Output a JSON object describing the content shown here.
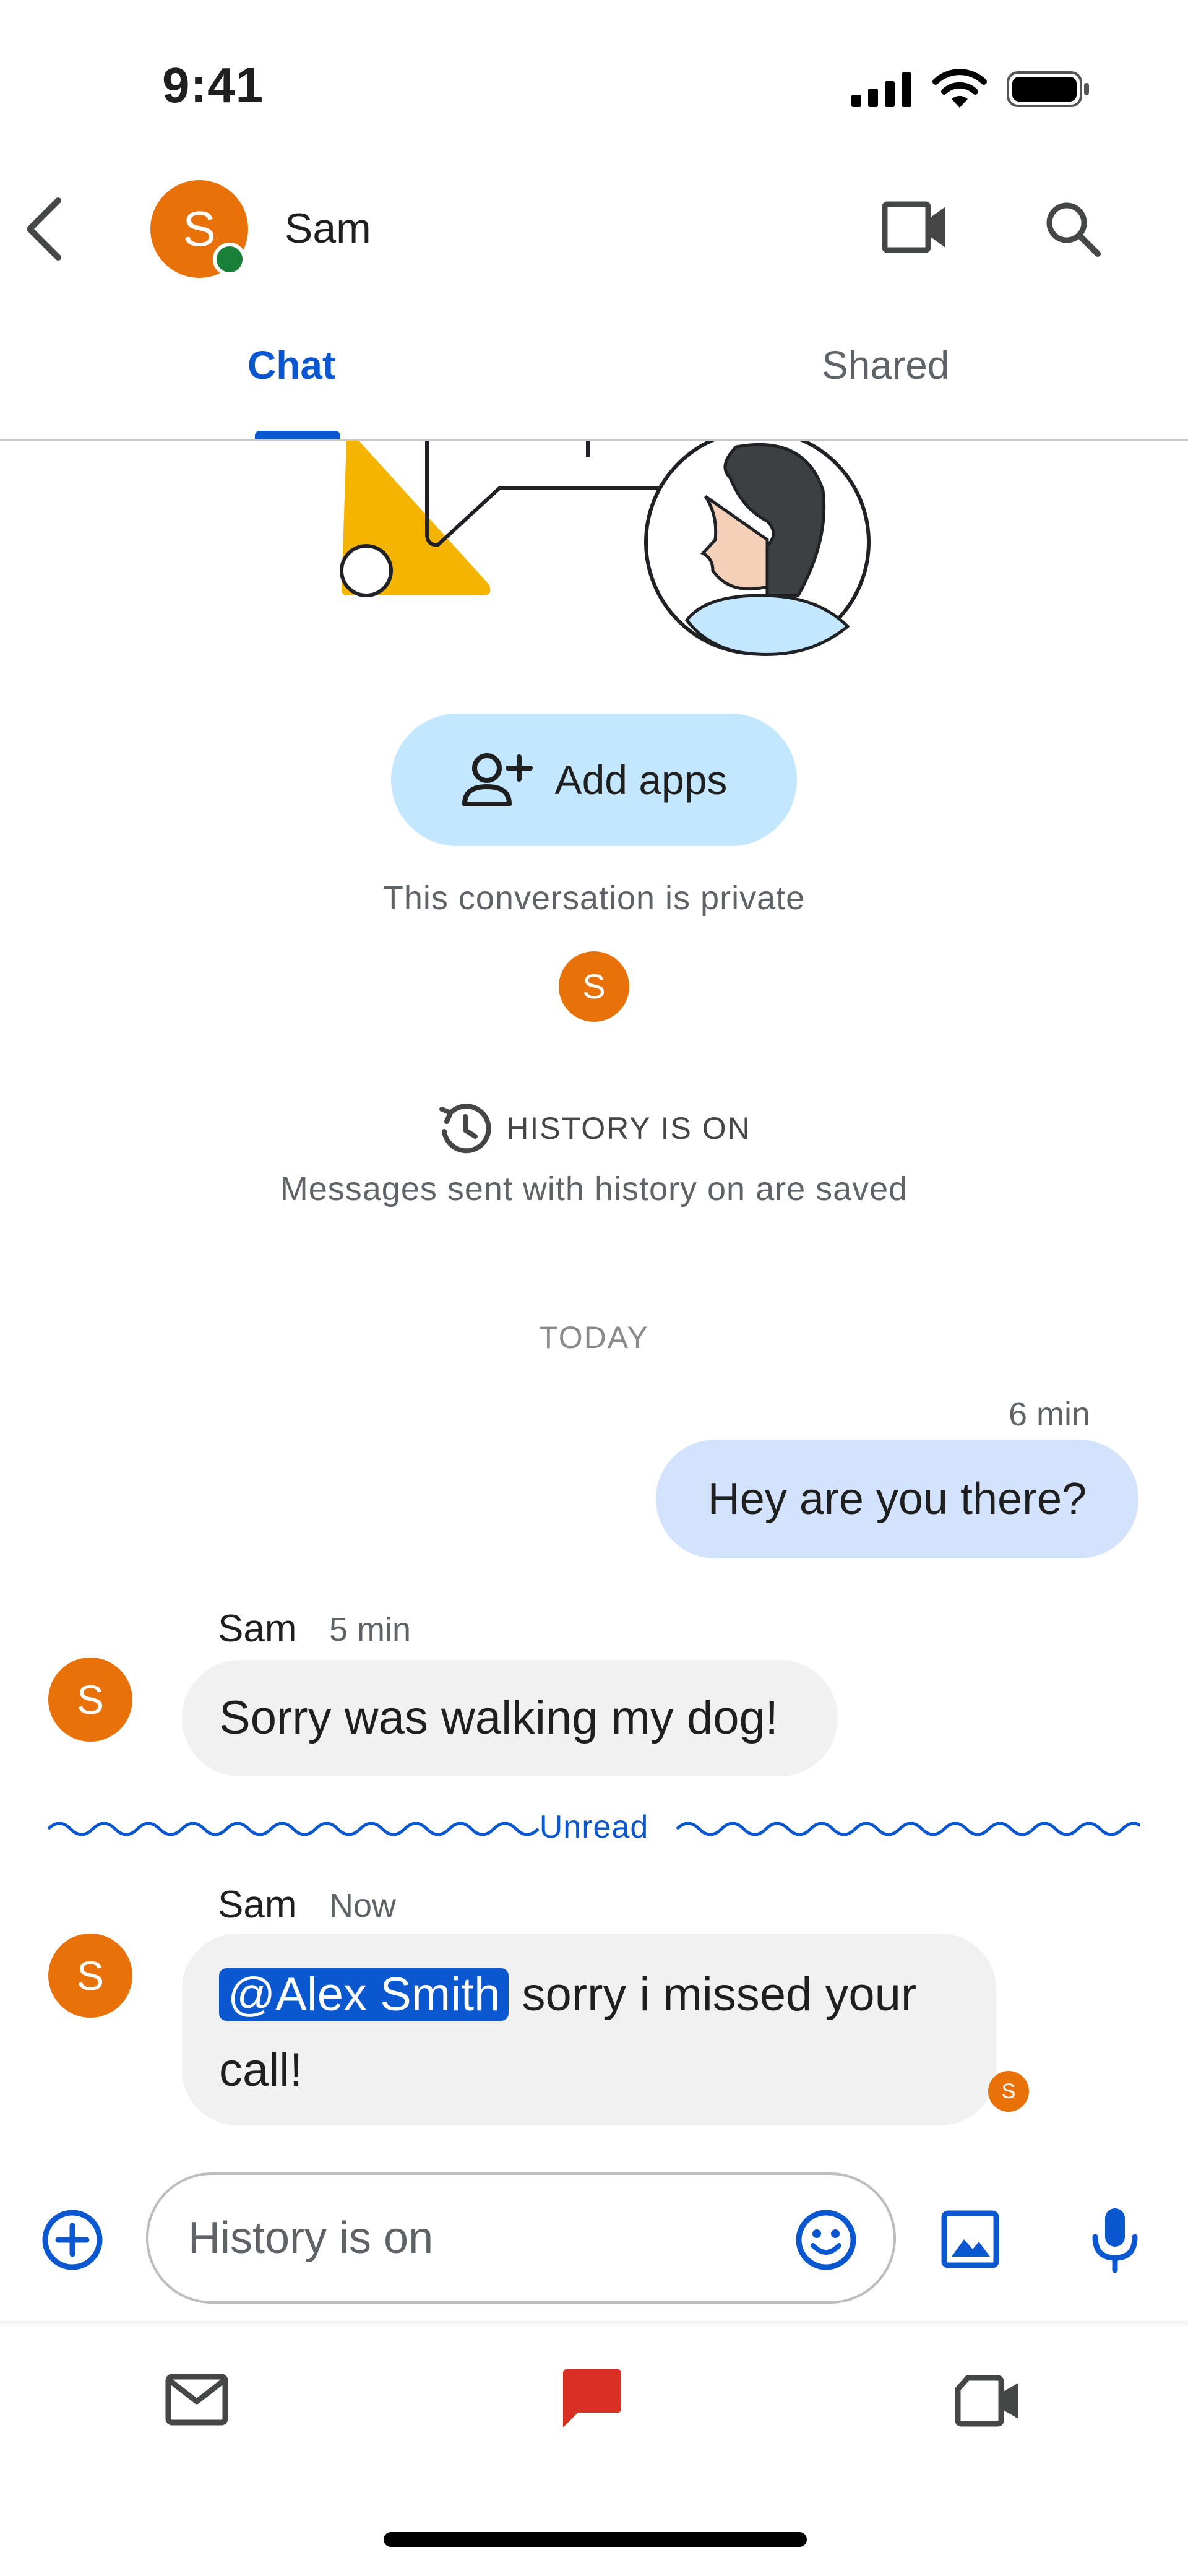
{
  "status_bar": {
    "time": "9:41"
  },
  "header": {
    "contact_name": "Sam",
    "avatar_initial": "S",
    "tabs": [
      {
        "label": "Chat",
        "selected": true
      },
      {
        "label": "Shared",
        "selected": false
      }
    ]
  },
  "intro": {
    "add_apps_label": "Add apps",
    "private_text": "This conversation is private",
    "participant_initial": "S",
    "history_title": "HISTORY IS ON",
    "history_subtitle": "Messages sent with history on are saved"
  },
  "messages": {
    "date_divider": "TODAY",
    "outgoing": {
      "time": "6 min",
      "text": "Hey are you there?"
    },
    "incoming_1": {
      "sender": "Sam",
      "time": "5 min",
      "avatar_initial": "S",
      "text": "Sorry was walking my dog!"
    },
    "unread_label": "Unread",
    "incoming_2": {
      "sender": "Sam",
      "time": "Now",
      "avatar_initial": "S",
      "mention": "@Alex Smith",
      "text_line1": " sorry i missed your",
      "text_line2": "call!",
      "read_receipt_initial": "S"
    }
  },
  "composer": {
    "placeholder": "History is on"
  },
  "bottom_nav": [
    {
      "icon": "mail-icon",
      "selected": false
    },
    {
      "icon": "chat-icon",
      "selected": true
    },
    {
      "icon": "video-call-icon",
      "selected": false
    }
  ],
  "colors": {
    "accent": "#0b57d0",
    "avatar": "#e8710a",
    "presence": "#188038",
    "outgoing_bubble": "#d3e3fd",
    "incoming_bubble": "#f1f1f1",
    "add_apps_button": "#c2e7ff",
    "chat_selected_icon": "#d93025"
  }
}
